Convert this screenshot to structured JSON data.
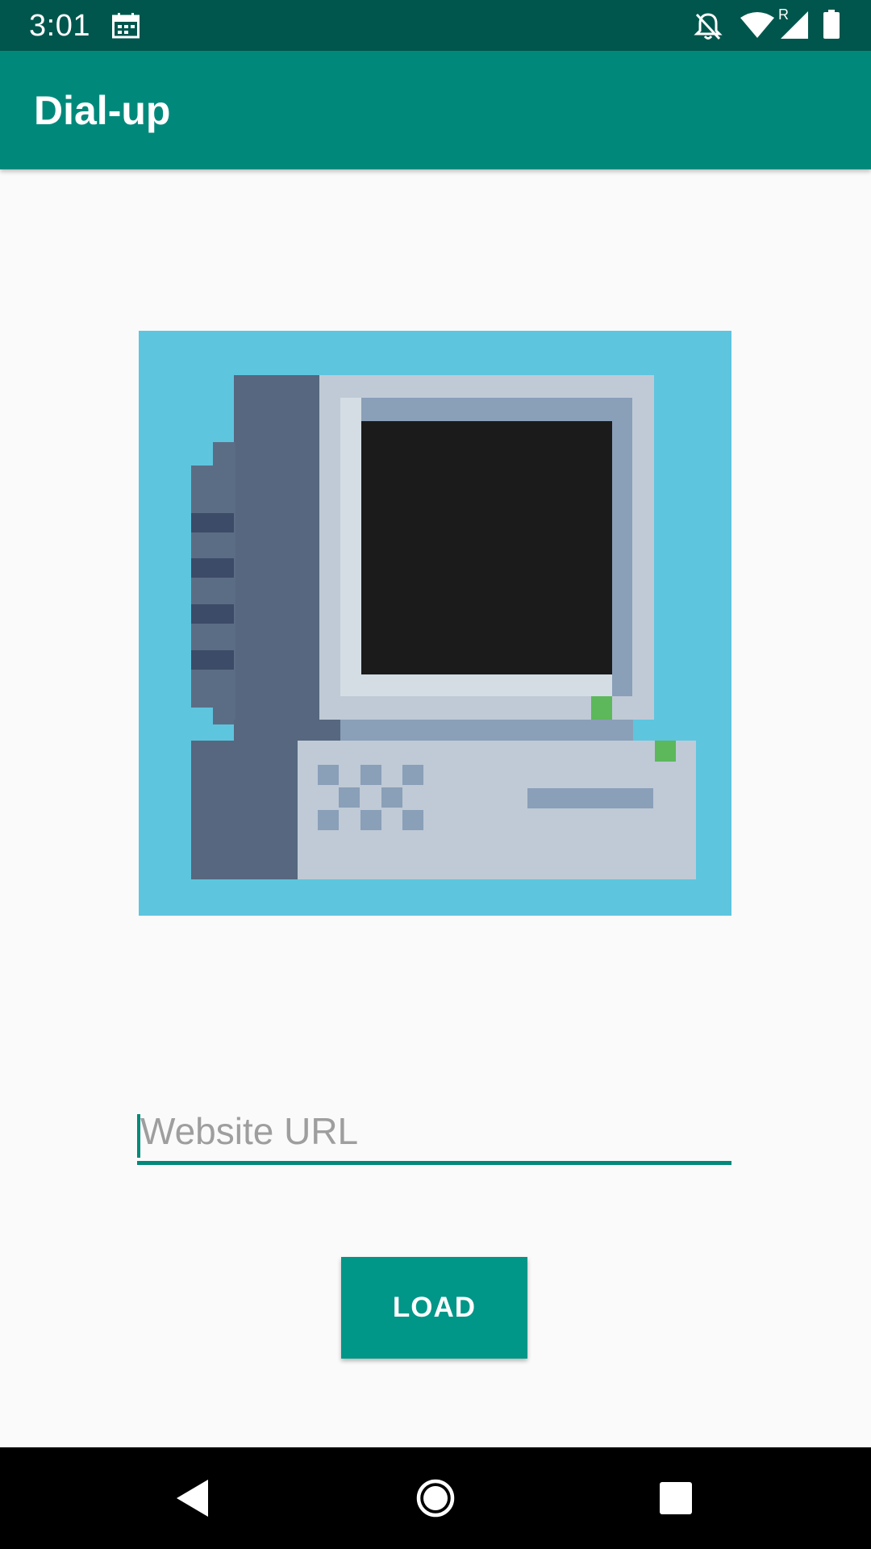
{
  "status_bar": {
    "time": "3:01",
    "icons": [
      "calendar-icon",
      "notifications-off-icon",
      "wifi-icon",
      "roaming-indicator",
      "cell-signal-icon",
      "battery-icon"
    ],
    "roaming_label": "R",
    "background": "#00564d"
  },
  "app_bar": {
    "title": "Dial-up",
    "color": "#00897b"
  },
  "illustration": {
    "icon": "retro-computer-illustration",
    "background": "#5ec5df"
  },
  "url_input": {
    "placeholder": "Website URL",
    "value": "",
    "accent": "#00897b"
  },
  "load_button": {
    "label": "LOAD",
    "color": "#009688"
  },
  "nav_bar": {
    "items": [
      "back-icon",
      "home-icon",
      "recents-icon"
    ]
  }
}
